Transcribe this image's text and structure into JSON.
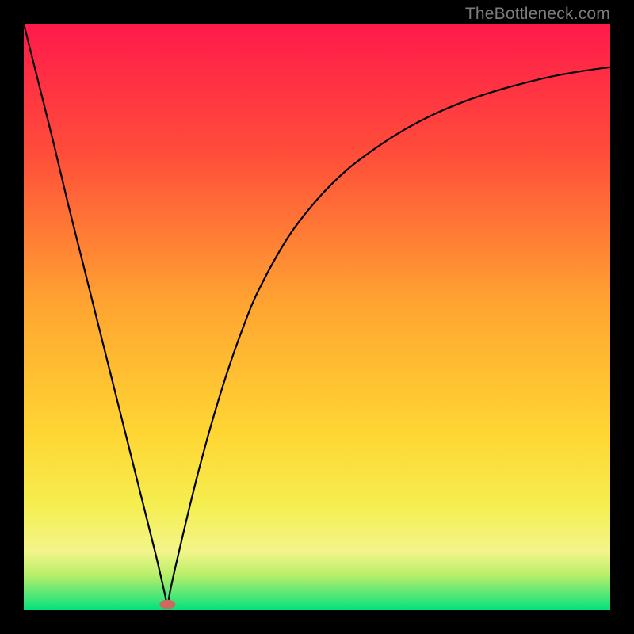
{
  "watermark": "TheBottleneck.com",
  "chart_data": {
    "type": "line",
    "title": "",
    "xlabel": "",
    "ylabel": "",
    "xlim": [
      0,
      100
    ],
    "ylim": [
      0,
      100
    ],
    "grid": false,
    "legend": false,
    "gradient_stops": [
      {
        "offset": 0,
        "color": "#ff1a4b"
      },
      {
        "offset": 0.22,
        "color": "#ff4d3a"
      },
      {
        "offset": 0.48,
        "color": "#ffa531"
      },
      {
        "offset": 0.7,
        "color": "#ffd633"
      },
      {
        "offset": 0.82,
        "color": "#f5ee4f"
      },
      {
        "offset": 0.9,
        "color": "#f3f58a"
      },
      {
        "offset": 0.94,
        "color": "#b8ef69"
      },
      {
        "offset": 0.97,
        "color": "#5fe877"
      },
      {
        "offset": 1.0,
        "color": "#00e27a"
      }
    ],
    "marker": {
      "x": 24.5,
      "y": 1.0,
      "color": "#cc6a5d",
      "rx": 10,
      "ry": 6
    },
    "series": [
      {
        "name": "curve",
        "x": [
          0.0,
          2.5,
          5.0,
          7.5,
          10.0,
          12.5,
          15.0,
          17.5,
          20.0,
          22.5,
          24.0,
          24.5,
          25.0,
          26.0,
          28.0,
          30.0,
          32.5,
          35.0,
          37.5,
          40.0,
          45.0,
          50.0,
          55.0,
          60.0,
          65.0,
          70.0,
          75.0,
          80.0,
          85.0,
          90.0,
          95.0,
          100.0
        ],
        "y": [
          100.0,
          90.0,
          80.0,
          69.5,
          59.5,
          49.5,
          39.5,
          29.5,
          19.5,
          9.5,
          3.0,
          1.0,
          3.5,
          8.0,
          16.5,
          24.5,
          33.5,
          41.5,
          48.5,
          54.5,
          63.5,
          70.0,
          75.0,
          78.8,
          82.0,
          84.6,
          86.7,
          88.4,
          89.8,
          91.0,
          91.9,
          92.6
        ]
      }
    ]
  }
}
